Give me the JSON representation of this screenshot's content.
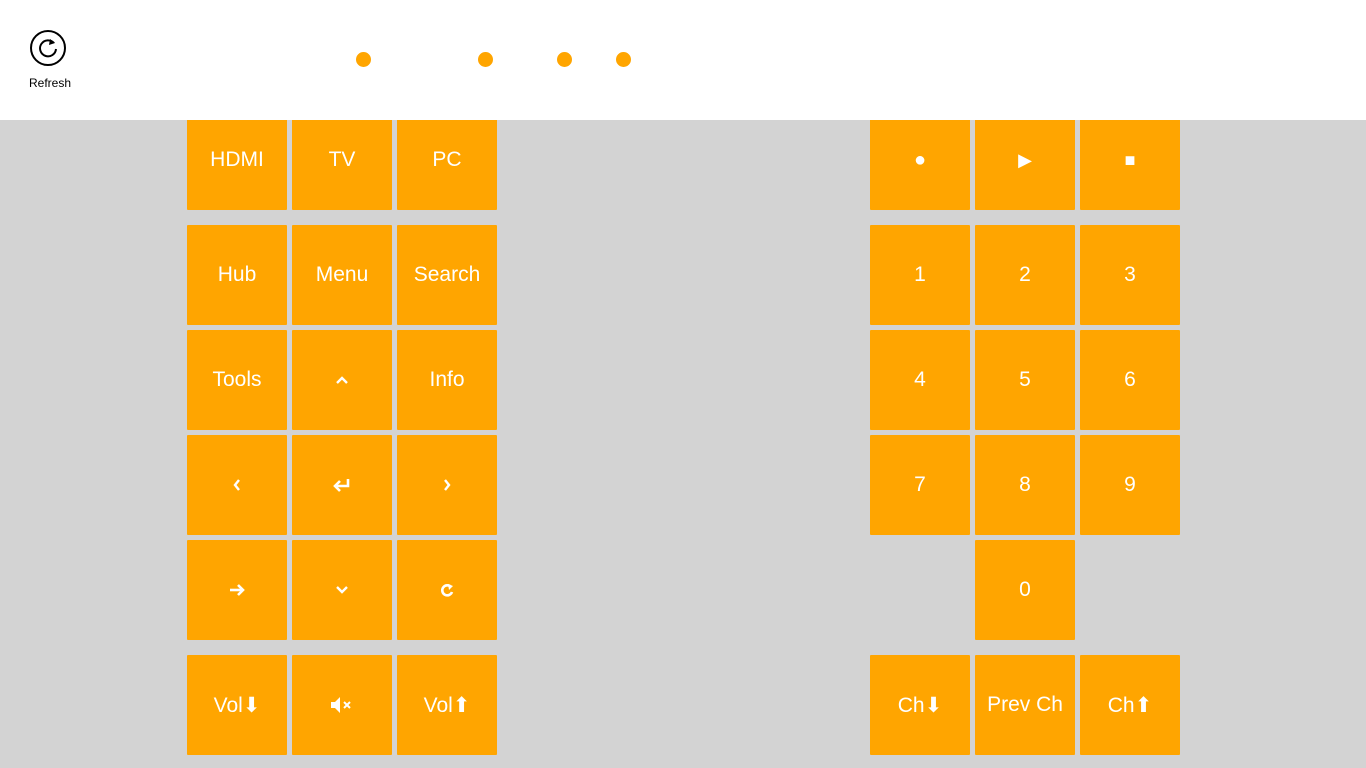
{
  "appbar": {
    "refresh_label": "Refresh",
    "refresh_icon": "refresh-icon"
  },
  "progress_indicator": {
    "dot_color": "#ffa500",
    "dot_count": 4
  },
  "colors": {
    "accent": "#ffa500",
    "background": "#d3d3d3",
    "appbar": "#ffffff",
    "text_on_accent": "#ffffff"
  },
  "left_panel": {
    "source": {
      "hdmi": "HDMI",
      "tv": "TV",
      "pc": "PC"
    },
    "nav": {
      "hub": "Hub",
      "menu": "Menu",
      "search": "Search",
      "tools": "Tools",
      "up_icon": "chevron-up-icon",
      "info": "Info",
      "left_icon": "chevron-left-icon",
      "enter_icon": "enter-icon",
      "right_icon": "chevron-right-icon",
      "exit_icon": "exit-arrow-icon",
      "down_icon": "chevron-down-icon",
      "return_icon": "return-icon"
    },
    "volume": {
      "vol_down": "Vol⬇",
      "mute_icon": "mute-icon",
      "vol_up": "Vol⬆"
    }
  },
  "right_panel": {
    "media": {
      "record": "●",
      "play": "▶",
      "stop": "■"
    },
    "keypad": [
      "1",
      "2",
      "3",
      "4",
      "5",
      "6",
      "7",
      "8",
      "9",
      "0"
    ],
    "channel": {
      "ch_down": "Ch⬇",
      "prev_ch": "Prev Ch",
      "ch_up": "Ch⬆"
    }
  }
}
